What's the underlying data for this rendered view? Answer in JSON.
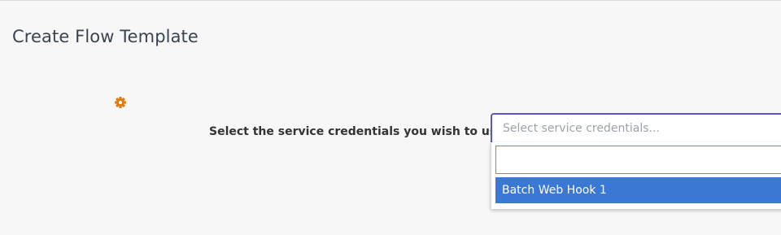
{
  "page": {
    "title": "Create Flow Template"
  },
  "form": {
    "credentials_label": "Select the service credentials you wish to use:",
    "credentials_select": {
      "placeholder": "Select service credentials...",
      "search_value": "",
      "options": [
        "Batch Web Hook 1"
      ],
      "highlighted_option": "Batch Web Hook 1"
    }
  },
  "icons": {
    "settings": "gear-icon"
  },
  "colors": {
    "title_text": "#3b4351",
    "gear_icon": "#e07b0a",
    "select_focus_border": "#5b55c8",
    "search_border": "#4c9bd5",
    "highlighted_option_bg": "#3a78d6",
    "background": "#f7f7f7"
  }
}
